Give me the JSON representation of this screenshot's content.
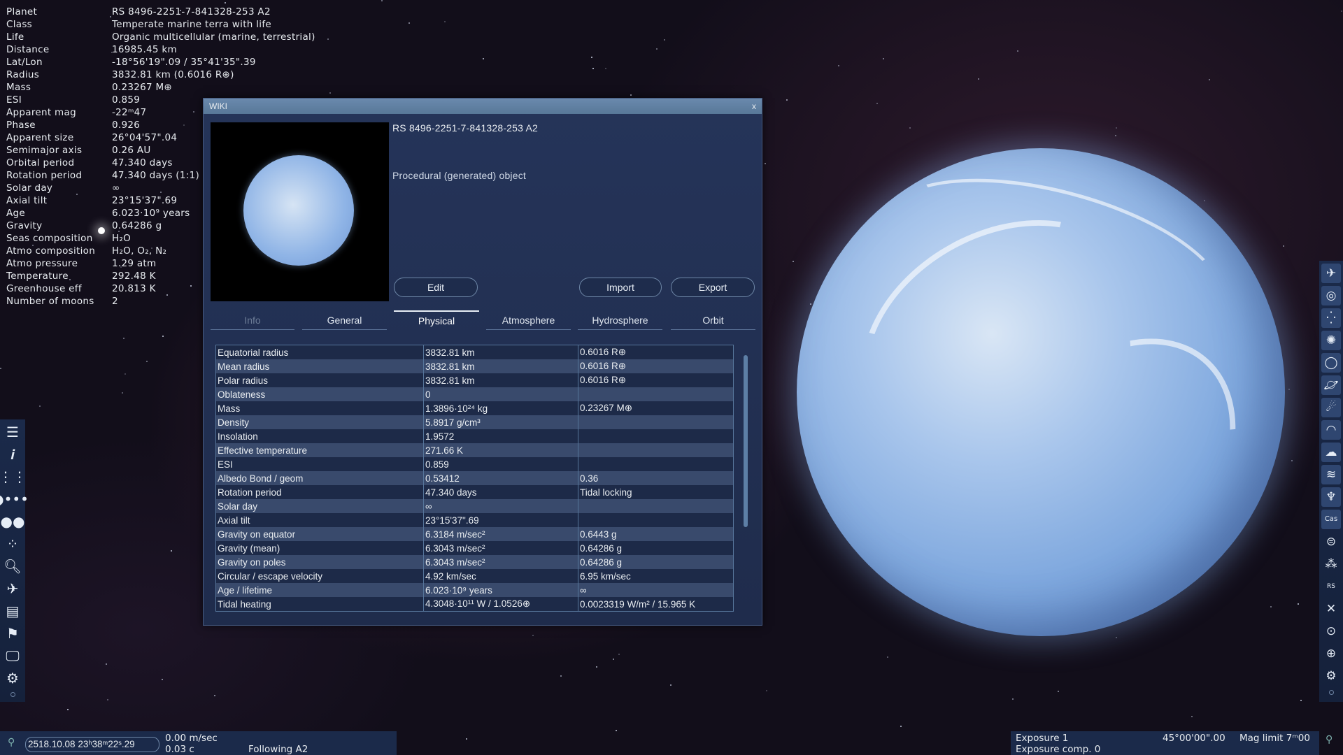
{
  "info_panel": {
    "rows": [
      {
        "label": "Planet",
        "value": "RS 8496-2251-7-841328-253 A2"
      },
      {
        "label": "Class",
        "value": "Temperate marine terra with life"
      },
      {
        "label": "Life",
        "value": "Organic multicellular (marine, terrestrial)"
      },
      {
        "label": "Distance",
        "value": "16985.45 km"
      },
      {
        "label": "Lat/Lon",
        "value": "-18°56'19\".09 / 35°41'35\".39"
      },
      {
        "label": "Radius",
        "value": "3832.81 km (0.6016 R⊕)"
      },
      {
        "label": "Mass",
        "value": "0.23267 M⊕"
      },
      {
        "label": "ESI",
        "value": "0.859"
      },
      {
        "label": "Apparent mag",
        "value": "-22ᵐ47"
      },
      {
        "label": "Phase",
        "value": "0.926"
      },
      {
        "label": "Apparent size",
        "value": "26°04'57\".04"
      },
      {
        "label": "Semimajor axis",
        "value": "0.26 AU"
      },
      {
        "label": "Orbital period",
        "value": "47.340 days"
      },
      {
        "label": "Rotation period",
        "value": "47.340 days (1:1)"
      },
      {
        "label": "Solar day",
        "value": "∞"
      },
      {
        "label": "Axial tilt",
        "value": "23°15'37\".69"
      },
      {
        "label": "Age",
        "value": "6.023·10⁹ years"
      },
      {
        "label": "Gravity",
        "value": "0.64286 g"
      },
      {
        "label": "Seas composition",
        "value": "H₂O"
      },
      {
        "label": "Atmo composition",
        "value": "H₂O, O₂, N₂"
      },
      {
        "label": "Atmo pressure",
        "value": "1.29 atm"
      },
      {
        "label": "Temperature",
        "value": "292.48 K"
      },
      {
        "label": "Greenhouse eff",
        "value": "20.813 K"
      },
      {
        "label": "Number of moons",
        "value": "2"
      }
    ]
  },
  "wiki": {
    "title": "WIKI",
    "close": "x",
    "object_name": "RS 8496-2251-7-841328-253 A2",
    "description": "Procedural (generated) object",
    "buttons": {
      "edit": "Edit",
      "import": "Import",
      "export": "Export"
    },
    "tabs": [
      {
        "label": "Info",
        "state": "disabled"
      },
      {
        "label": "General",
        "state": "normal"
      },
      {
        "label": "Physical",
        "state": "active"
      },
      {
        "label": "Atmosphere",
        "state": "normal"
      },
      {
        "label": "Hydrosphere",
        "state": "normal"
      },
      {
        "label": "Orbit",
        "state": "normal"
      }
    ],
    "table": [
      [
        "Equatorial radius",
        "3832.81 km",
        "0.6016 R⊕"
      ],
      [
        "Mean radius",
        "3832.81 km",
        "0.6016 R⊕"
      ],
      [
        "Polar radius",
        "3832.81 km",
        "0.6016 R⊕"
      ],
      [
        "Oblateness",
        "0",
        ""
      ],
      [
        "Mass",
        "1.3896·10²⁴ kg",
        "0.23267 M⊕"
      ],
      [
        "Density",
        "5.8917 g/cm³",
        ""
      ],
      [
        "Insolation",
        "1.9572",
        ""
      ],
      [
        "Effective temperature",
        "271.66 K",
        ""
      ],
      [
        "ESI",
        "0.859",
        ""
      ],
      [
        "Albedo Bond / geom",
        "0.53412",
        "0.36"
      ],
      [
        "Rotation period",
        "47.340 days",
        "Tidal locking"
      ],
      [
        "Solar day",
        "∞",
        ""
      ],
      [
        "Axial tilt",
        "23°15'37\".69",
        ""
      ],
      [
        "Gravity on equator",
        "6.3184 m/sec²",
        "0.6443 g"
      ],
      [
        "Gravity (mean)",
        "6.3043 m/sec²",
        "0.64286 g"
      ],
      [
        "Gravity on poles",
        "6.3043 m/sec²",
        "0.64286 g"
      ],
      [
        "Circular / escape velocity",
        "4.92 km/sec",
        "6.95 km/sec"
      ],
      [
        "Age / lifetime",
        "6.023·10⁹ years",
        "∞"
      ],
      [
        "Tidal heating",
        "4.3048·10¹¹ W / 1.0526⊕",
        "0.0023319 W/m² / 15.965 K"
      ]
    ]
  },
  "left_toolbar": [
    "menu-icon",
    "info-icon",
    "planetarium-icon",
    "solar-system-icon",
    "star-browser-icon",
    "star-field-icon",
    "search-icon",
    "spaceship-icon",
    "journal-icon",
    "flag-icon",
    "display-icon",
    "settings-icon"
  ],
  "right_toolbar": [
    "spaceship-icon",
    "galaxy-icon",
    "stars-icon",
    "cluster-icon",
    "nebula-icon",
    "planet-icon",
    "comet-icon",
    "atmosphere-icon",
    "clouds-icon",
    "water-icon",
    "aurora-icon",
    "constellation-icon",
    "orbits-icon",
    "markers-icon",
    "labels-icon",
    "reticle-icon",
    "grid-icon",
    "globe-grid-icon",
    "settings-icon"
  ],
  "constellation_label": "Cas",
  "labels_label": "RS",
  "status_left": {
    "datetime": "2518.10.08 23ʰ38ᵐ22ˢ.29",
    "speed": "0.00 m/sec",
    "speed_c": "0.03 c",
    "following": "Following A2"
  },
  "status_right": {
    "exposure": "Exposure 1",
    "exposure_comp": "Exposure comp. 0",
    "fov": "45°00'00\".00",
    "mag_limit": "Mag limit 7ᵐ00"
  }
}
